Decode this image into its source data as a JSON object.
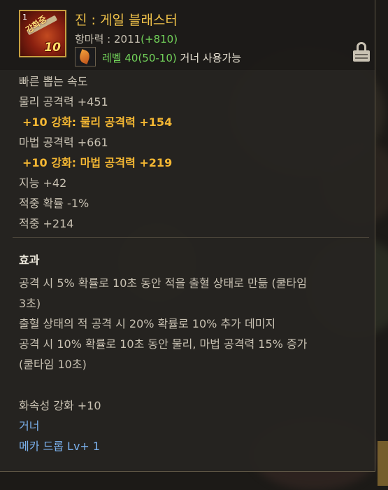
{
  "item": {
    "name": "진 : 게일 블래스터",
    "icon_stamp": "강화중",
    "icon_count": "10",
    "icon_corner": "1"
  },
  "resist": {
    "label": "항마력 : 2011",
    "bonus": "(+810)"
  },
  "requirement": {
    "level": "레벨 40(50-10)",
    "class": " 거너 사용가능"
  },
  "stats": [
    "빠른 뽑는 속도",
    "물리 공격력 +451",
    "+10 강화: 물리 공격력 +154",
    "마법 공격력 +661",
    "+10 강화: 마법 공격력 +219",
    "지능 +42",
    "적중 확률 -1%",
    "적중 +214"
  ],
  "effect": {
    "title": "효과",
    "lines": [
      "공격 시 5% 확률로 10초 동안 적을 출혈 상태로 만듦 (쿨타임",
      "3초)",
      "출혈 상태의 적 공격 시 20% 확률로 10% 추가 데미지",
      "공격 시 10% 확률로 10초 동안 물리, 마법 공격력 15% 증가",
      "(쿨타임 10초)"
    ]
  },
  "footer": {
    "element": "화속성 강화 +10",
    "class": "거너",
    "skill": "메카 드롭 Lv+ 1"
  },
  "colors": {
    "name": "#f2c44a",
    "bonus": "#72d35a",
    "enhance": "#f4b733",
    "skill": "#7ab0ec"
  },
  "icons": [
    "item-weapon-icon",
    "gunner-class-icon",
    "lock-icon"
  ]
}
